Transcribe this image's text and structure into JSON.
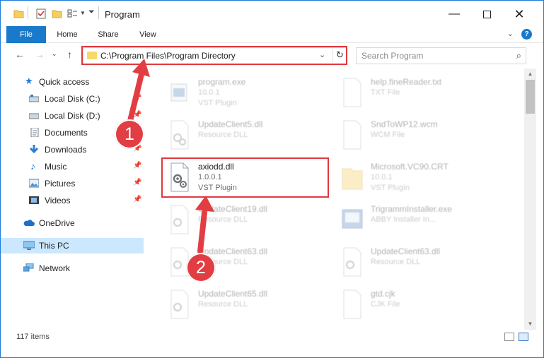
{
  "window": {
    "title": "Program"
  },
  "ribbon": {
    "tabs": [
      "File",
      "Home",
      "Share",
      "View"
    ],
    "help": "?"
  },
  "address": {
    "path": "C:\\Program Files\\Program Directory"
  },
  "search": {
    "placeholder": "Search Program"
  },
  "nav": {
    "items": [
      {
        "label": "Quick access",
        "icon": "star-icon",
        "pinned": false
      },
      {
        "label": "Local Disk (C:)",
        "icon": "drive-icon",
        "pinned": true
      },
      {
        "label": "Local Disk (D:)",
        "icon": "drive-icon",
        "pinned": true
      },
      {
        "label": "Documents",
        "icon": "documents-icon",
        "pinned": true
      },
      {
        "label": "Downloads",
        "icon": "download-icon",
        "pinned": true
      },
      {
        "label": "Music",
        "icon": "music-icon",
        "pinned": true
      },
      {
        "label": "Pictures",
        "icon": "pictures-icon",
        "pinned": true
      },
      {
        "label": "Videos",
        "icon": "videos-icon",
        "pinned": true
      },
      {
        "label": "OneDrive",
        "icon": "cloud-icon",
        "pinned": false
      },
      {
        "label": "This PC",
        "icon": "pc-icon",
        "pinned": false,
        "selected": true
      },
      {
        "label": "Network",
        "icon": "network-icon",
        "pinned": false
      }
    ]
  },
  "files": [
    {
      "name": "program.exe",
      "sub": "10.0.1",
      "sub2": "VST Plugin",
      "icon": "exe-icon",
      "highlighted": false
    },
    {
      "name": "help.fineReader.txt",
      "sub": "TXT File",
      "sub2": "",
      "icon": "text-file-icon",
      "highlighted": false
    },
    {
      "name": "UpdateClient5.dll",
      "sub": "Resource DLL",
      "sub2": "",
      "icon": "dll-icon",
      "highlighted": false
    },
    {
      "name": "SndToWP12.wcm",
      "sub": "WCM File",
      "sub2": "",
      "icon": "blank-file-icon",
      "highlighted": false
    },
    {
      "name": "axiodd.dll",
      "sub": "1.0.0.1",
      "sub2": "VST Plugin",
      "icon": "dll-icon",
      "highlighted": true
    },
    {
      "name": "Microsoft.VC90.CRT",
      "sub": "10.0.1",
      "sub2": "VST Plugin",
      "icon": "folder-icon",
      "highlighted": false
    },
    {
      "name": "UpdateClient19.dll",
      "sub": "Resource DLL",
      "sub2": "",
      "icon": "dll-icon",
      "highlighted": false
    },
    {
      "name": "TrigrammInstaller.exe",
      "sub": "ABBY Installer In...",
      "sub2": "",
      "icon": "installer-icon",
      "highlighted": false
    },
    {
      "name": "UpdateClient63.dll",
      "sub": "Resource DLL",
      "sub2": "",
      "icon": "dll-icon",
      "highlighted": false
    },
    {
      "name": "UpdateClient63.dll",
      "sub": "Resource DLL",
      "sub2": "",
      "icon": "dll-icon",
      "highlighted": false
    },
    {
      "name": "UpdateClient65.dll",
      "sub": "Resource DLL",
      "sub2": "",
      "icon": "dll-icon",
      "highlighted": false
    },
    {
      "name": "gtd.cjk",
      "sub": "CJK File",
      "sub2": "",
      "icon": "blank-file-icon",
      "highlighted": false
    }
  ],
  "status": {
    "item_count": "117 items"
  },
  "annotations": {
    "step1": "1",
    "step2": "2",
    "accent": "#e23d43"
  }
}
